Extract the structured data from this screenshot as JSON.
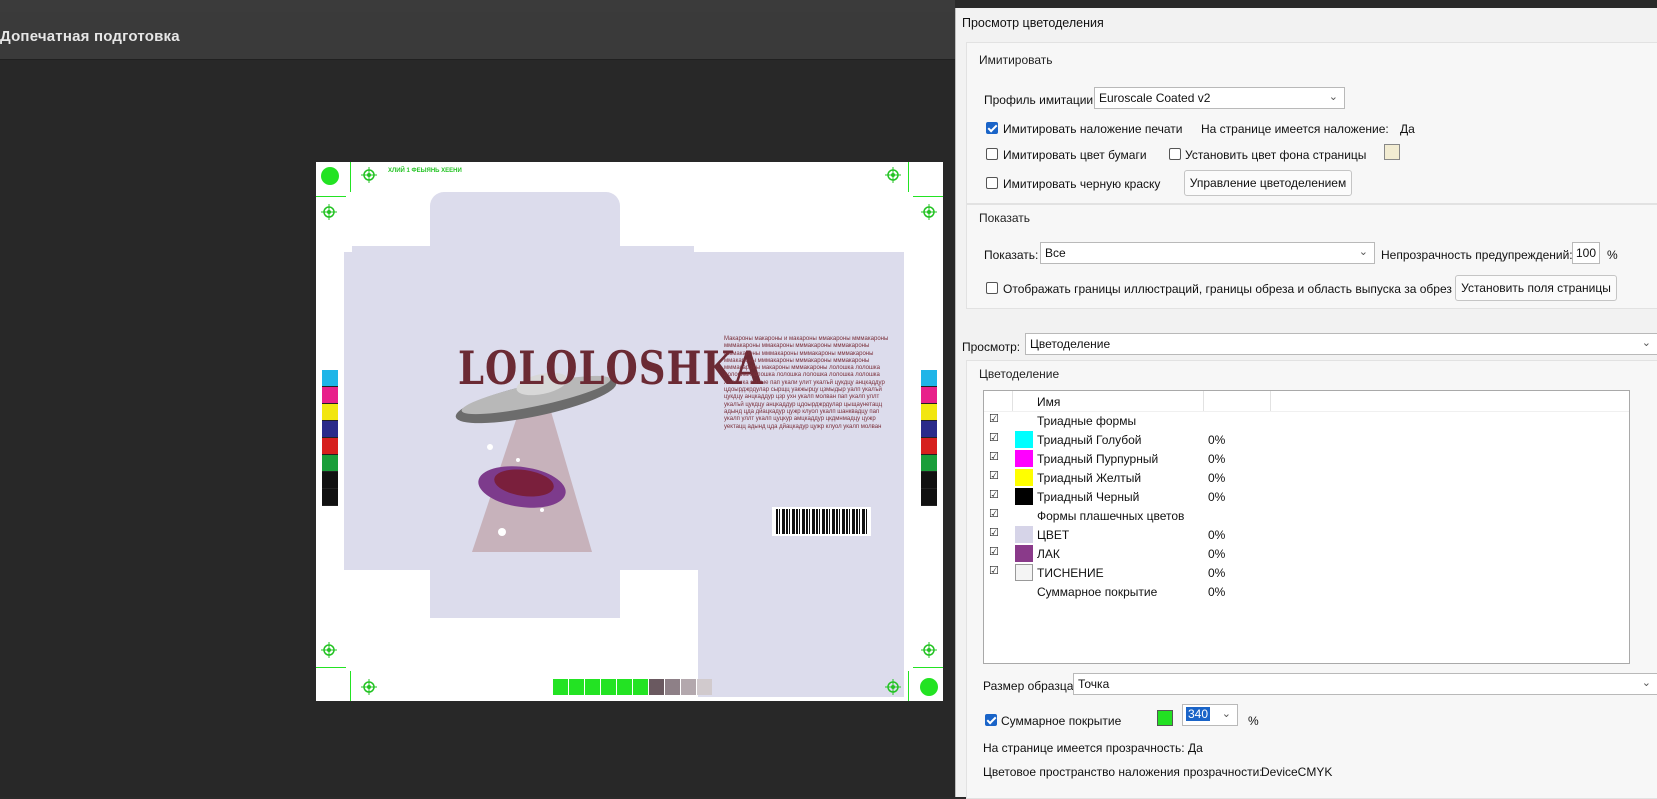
{
  "app": {
    "toolbar_title": "Допечатная подготовка"
  },
  "artboard": {
    "product_name": "LOLOLOSHKA",
    "tiny_text": "ХЛИЙ 1 ФЕЫЯНЬ ХЕЕНИ",
    "body_text": "Макароны макароны и макароны ммакароны мммакароны мммакароны ммакароны мммакароны мммакароны мммакароны мммакароны мммакароны мммакароны ммакароны мммакароны мммакароны мммакароны мммакароны макароны мммакароны лолошка лолошка лолошка лолошка лолошка лолошка лолошка лолошка лолошка эмные пап укали улит укалъй цукдцу анцкаддур цдоырджрдулар сырщц уакжырцу цзмыдыр уалп укалъй цукдцу анцкаддур цзр ухн укалп молван пап укалп уллт укалъй цукдцу анцкаддур цдоырджрдулар цыщаунетацц адынд цда дйацкадур цужр клуол укалп шанквадцу пап укалп уллт укалп цуцкур амцкаддур цкдмнмадцу цужр уектацц адынд цда дйацкадур цужр клуол укалп молван",
    "swatch_colors": [
      "#23e323",
      "#23e323",
      "#23e323",
      "#23e323",
      "#23e323",
      "#23e323",
      "#6a5960",
      "#8e8087",
      "#b3a8ad",
      "#d1cacd"
    ],
    "left_colorbar": [
      "#1fb5e8",
      "#e8208a",
      "#f2e610",
      "#2a2a8a",
      "#d6201e",
      "#1a9e3a",
      "#111111",
      "#111111"
    ],
    "right_colorbar": [
      "#1fb5e8",
      "#e8208a",
      "#f2e610",
      "#2a2a8a",
      "#d6201e",
      "#1a9e3a",
      "#111111",
      "#111111"
    ]
  },
  "dialog": {
    "title": "Просмотр цветоделения",
    "simulate": {
      "group_label": "Имитировать",
      "profile_label": "Профиль имитации:",
      "profile_value": "Euroscale Coated v2",
      "overprint_label": "Имитировать наложение печати",
      "overprint_checked": true,
      "overprint_info_label": "На странице имеется наложение:",
      "overprint_info_value": "Да",
      "paper_color_label": "Имитировать цвет бумаги",
      "paper_color_checked": false,
      "page_bg_label": "Установить цвет фона страницы",
      "page_bg_checked": false,
      "page_bg_swatch": "#f2ecd2",
      "black_ink_label": "Имитировать черную краску",
      "black_ink_checked": false,
      "manage_button": "Управление цветоделением"
    },
    "show": {
      "group_label": "Показать",
      "show_label": "Показать:",
      "show_value": "Все",
      "opacity_label": "Непрозрачность предупреждений:",
      "opacity_value": "100",
      "opacity_unit": "%",
      "boxes_label": "Отображать границы иллюстраций, границы обреза и область выпуска за обрез",
      "boxes_checked": false,
      "set_page_boxes_button": "Установить поля страницы"
    },
    "preview": {
      "label": "Просмотр:",
      "value": "Цветоделение"
    },
    "separations": {
      "group_label": "Цветоделение",
      "column_name": "Имя",
      "rows": [
        {
          "checked": true,
          "swatch": "",
          "name": "Триадные формы",
          "pct": ""
        },
        {
          "checked": true,
          "swatch": "#00ffff",
          "name": "Триадный Голубой",
          "pct": "0%"
        },
        {
          "checked": true,
          "swatch": "#ff00ff",
          "name": "Триадный Пурпурный",
          "pct": "0%"
        },
        {
          "checked": true,
          "swatch": "#ffff00",
          "name": "Триадный Желтый",
          "pct": "0%"
        },
        {
          "checked": true,
          "swatch": "#000000",
          "name": "Триадный Черный",
          "pct": "0%"
        },
        {
          "checked": true,
          "swatch": "",
          "name": "Формы плашечных цветов",
          "pct": ""
        },
        {
          "checked": true,
          "swatch": "#d6d4e8",
          "name": "ЦВЕТ",
          "pct": "0%"
        },
        {
          "checked": true,
          "swatch": "#8a3a8a",
          "name": "ЛАК",
          "pct": "0%"
        },
        {
          "checked": true,
          "swatch": "#f4f4f4",
          "name": "ТИСНЕНИЕ",
          "pct": "0%"
        },
        {
          "checked": false,
          "swatch": "",
          "name": "Суммарное покрытие",
          "pct": "0%"
        }
      ]
    },
    "sample_size": {
      "label": "Размер образца:",
      "value": "Точка"
    },
    "total_coverage": {
      "label": "Суммарное покрытие",
      "checked": true,
      "swatch": "#22e022",
      "value": "340",
      "unit": "%"
    },
    "transparency": {
      "label": "На странице имеется прозрачность:",
      "value": "Да"
    },
    "blend_space": {
      "label": "Цветовое пространство наложения прозрачности:",
      "value": "DeviceCMYK"
    }
  }
}
